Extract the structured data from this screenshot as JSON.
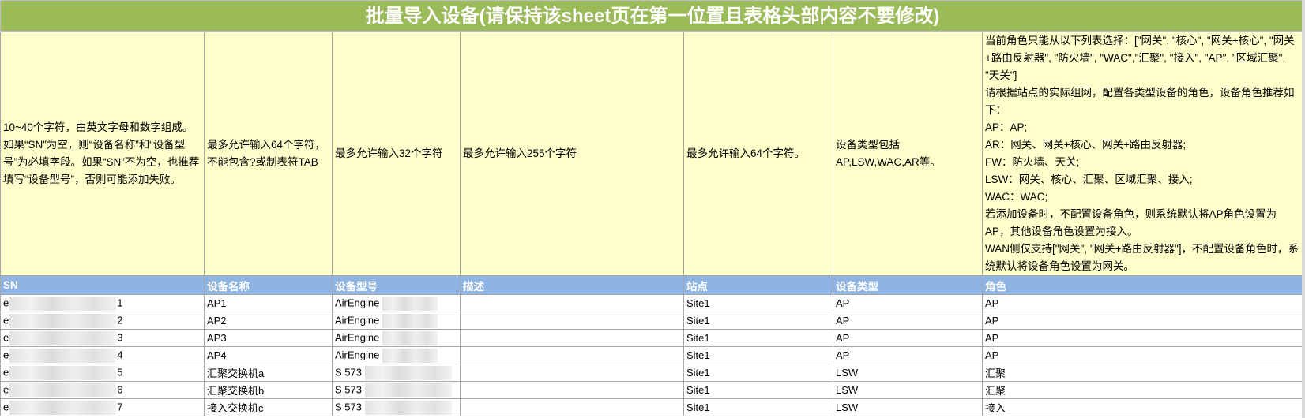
{
  "title": "批量导入设备(请保持该sheet页在第一位置且表格头部内容不要修改)",
  "descriptions": {
    "sn": "10~40个字符，由英文字母和数字组成。如果“SN”为空，则“设备名称”和“设备型号”为必填字段。如果“SN”不为空，也推荐填写“设备型号”，否则可能添加失败。",
    "name": "最多允许输入64个字符，不能包含?或制表符TAB",
    "model": "最多允许输入32个字符",
    "desc": "最多允许输入255个字符",
    "site": "最多允许输入64个字符。",
    "type": "设备类型包括AP,LSW,WAC,AR等。",
    "role_lines": [
      "当前角色只能从以下列表选择：[\"网关\", \"核心\", \"网关+核心\", \"网关+路由反射器\", \"防火墙\", \"WAC\",\"汇聚\", \"接入\", \"AP\", \"区域汇聚\", \"天关\"]",
      "请根据站点的实际组网，配置各类型设备的角色，设备角色推荐如下：",
      "AP：AP;",
      "AR：网关、网关+核心、网关+路由反射器;",
      "FW：防火墙、天关;",
      "LSW：网关、核心、汇聚、区域汇聚、接入;",
      "WAC：WAC;",
      "若添加设备时，不配置设备角色，则系统默认将AP角色设置为AP，其他设备角色设置为接入。",
      "WAN侧仅支持[\"网关\", \"网关+路由反射器\"]，不配置设备角色时，系统默认将设备角色设置为网关。"
    ]
  },
  "headers": {
    "sn": "SN",
    "name": "设备名称",
    "model": "设备型号",
    "desc": "描述",
    "site": "站点",
    "type": "设备类型",
    "role": "角色"
  },
  "rows": [
    {
      "sn_prefix": "e",
      "sn_suffix": "1",
      "name": "AP1",
      "model": "AirEngine",
      "desc": "",
      "site": "Site1",
      "type": "AP",
      "role": "AP"
    },
    {
      "sn_prefix": "e",
      "sn_suffix": "2",
      "name": "AP2",
      "model": "AirEngine",
      "desc": "",
      "site": "Site1",
      "type": "AP",
      "role": "AP"
    },
    {
      "sn_prefix": "e",
      "sn_suffix": "3",
      "name": "AP3",
      "model": "AirEngine",
      "desc": "",
      "site": "Site1",
      "type": "AP",
      "role": "AP"
    },
    {
      "sn_prefix": "e",
      "sn_suffix": "4",
      "name": "AP4",
      "model": "AirEngine",
      "desc": "",
      "site": "Site1",
      "type": "AP",
      "role": "AP"
    },
    {
      "sn_prefix": "e",
      "sn_suffix": "5",
      "name": "汇聚交换机a",
      "model": "S 573",
      "desc": "",
      "site": "Site1",
      "type": "LSW",
      "role": "汇聚"
    },
    {
      "sn_prefix": "e",
      "sn_suffix": "6",
      "name": "汇聚交换机b",
      "model": "S 573",
      "desc": "",
      "site": "Site1",
      "type": "LSW",
      "role": "汇聚"
    },
    {
      "sn_prefix": "e",
      "sn_suffix": "7",
      "name": "接入交换机c",
      "model": "S 573",
      "desc": "",
      "site": "Site1",
      "type": "LSW",
      "role": "接入"
    }
  ],
  "colors": {
    "title_bg": "#9bbb59",
    "description_bg": "#ffffcc",
    "header_bg": "#8db4e2"
  }
}
